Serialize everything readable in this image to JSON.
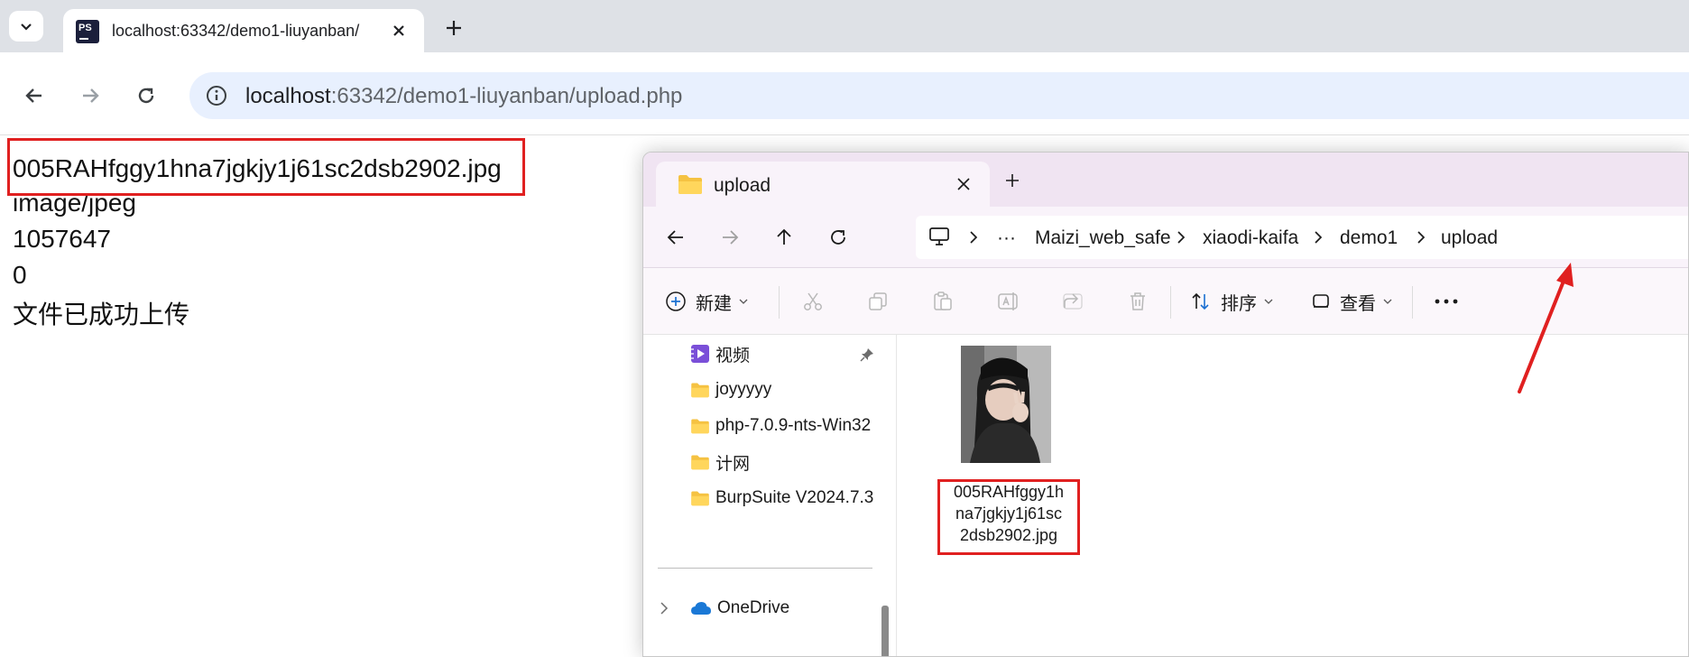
{
  "browser": {
    "tab": {
      "title": "localhost:63342/demo1-liuyanban/",
      "favicon": "PS"
    },
    "url": {
      "host": "localhost",
      "path": ":63342/demo1-liuyanban/upload.php"
    }
  },
  "page": {
    "lines": [
      "005RAHfggy1hna7jgkjy1j61sc2dsb2902.jpg",
      "image/jpeg",
      "1057647",
      "0",
      "文件已成功上传"
    ]
  },
  "explorer": {
    "tab_title": "upload",
    "breadcrumbs": [
      "Maizi_web_safe",
      "xiaodi-kaifa",
      "demo1",
      "upload"
    ],
    "breadcrumb_overflow": "···",
    "commands": {
      "new": "新建",
      "sort": "排序",
      "view": "查看"
    },
    "sidebar": [
      {
        "label": "视频",
        "icon": "video-folder-icon",
        "pinned": true
      },
      {
        "label": "joyyyyy",
        "icon": "folder-icon"
      },
      {
        "label": "php-7.0.9-nts-Win32",
        "icon": "folder-icon"
      },
      {
        "label": "计网",
        "icon": "folder-icon"
      },
      {
        "label": "BurpSuite V2024.7.3",
        "icon": "folder-icon"
      }
    ],
    "onedrive": "OneDrive",
    "file": {
      "name_lines": [
        "005RAHfggy1h",
        "na7jgkjy1j61sc",
        "2dsb2902.jpg"
      ]
    }
  },
  "colors": {
    "annotation_red": "#e02020",
    "explorer_title": "#f0e4f2",
    "omnibox": "#e8f0fe"
  }
}
